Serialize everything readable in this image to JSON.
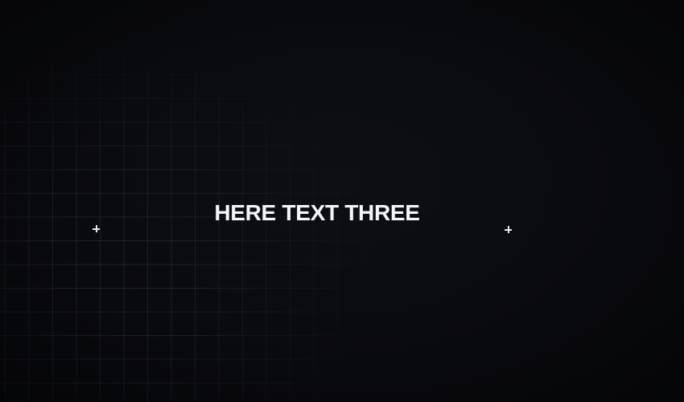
{
  "scene": {
    "headline": "HERE TEXT THREE",
    "background_color": "#0a0b10",
    "grid_color": "#6e7da0",
    "text_color": "#f4f5f7"
  },
  "icons": {
    "left_marker": "crosshair-plus-icon",
    "right_marker": "crosshair-plus-icon"
  }
}
